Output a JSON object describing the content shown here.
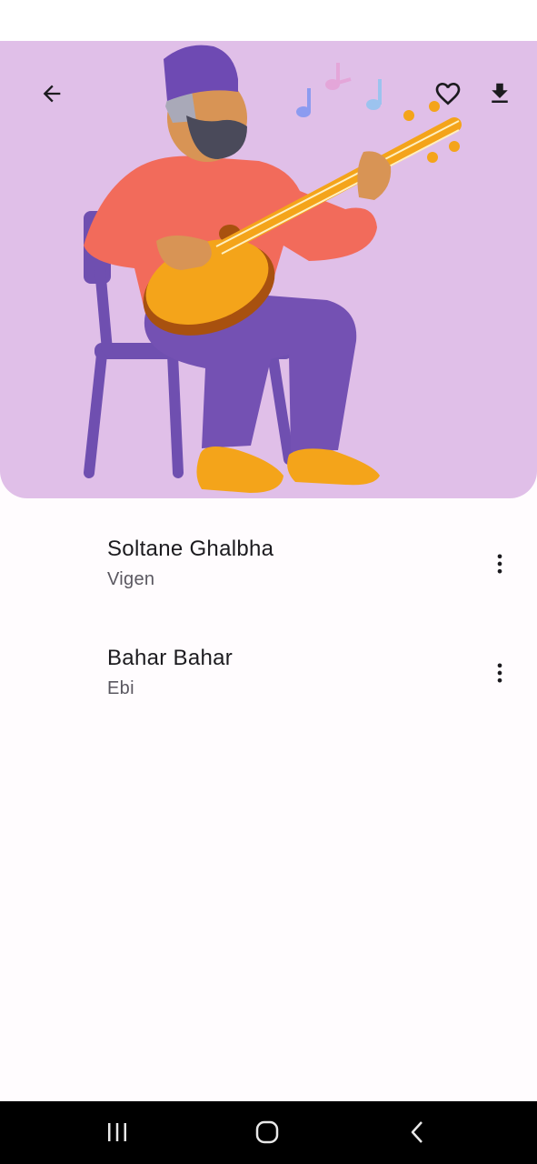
{
  "header": {
    "back_icon": "arrow-back-icon",
    "favorite_icon": "heart-outline-icon",
    "download_icon": "download-icon",
    "artwork": "musician-playing-tar-illustration"
  },
  "songs": [
    {
      "title": "Soltane Ghalbha",
      "artist": "Vigen",
      "menu_icon": "more-vert-icon"
    },
    {
      "title": "Bahar Bahar",
      "artist": "Ebi",
      "menu_icon": "more-vert-icon"
    }
  ],
  "navigation": {
    "recents_icon": "recent-apps-icon",
    "home_icon": "home-icon",
    "back_icon": "nav-back-icon"
  },
  "colors": {
    "hero_background": "#e0bfe8",
    "shirt": "#f26b5b",
    "pants": "#7451b3",
    "instrument": "#f4a41a",
    "nav_bar": "#000000"
  }
}
